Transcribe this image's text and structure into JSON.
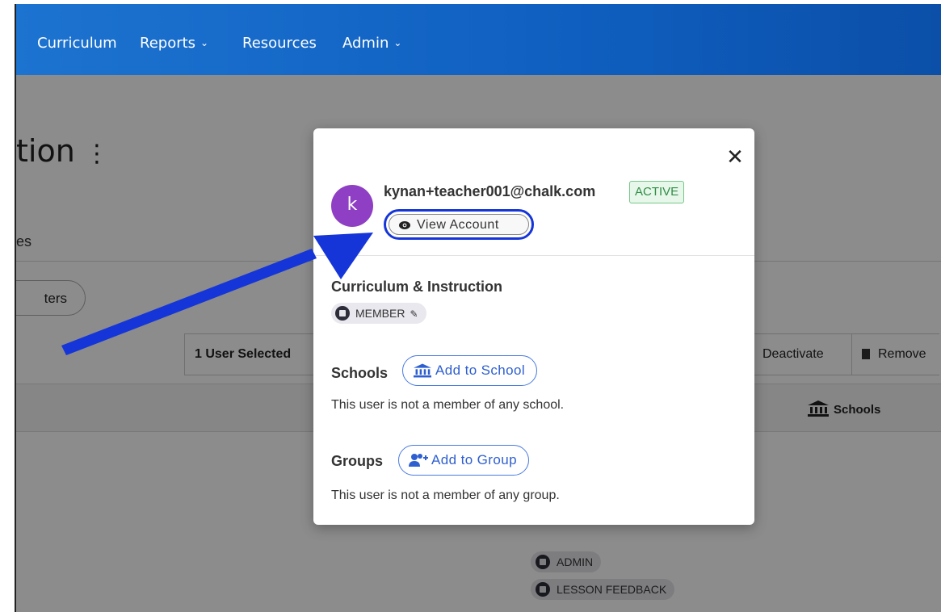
{
  "nav": {
    "items": [
      {
        "label": "Curriculum",
        "dropdown": false
      },
      {
        "label": "Reports",
        "dropdown": true
      },
      {
        "label": "Resources",
        "dropdown": false
      },
      {
        "label": "Admin",
        "dropdown": true
      }
    ],
    "chevron": "⌄"
  },
  "page": {
    "title_fragment": "tion",
    "title_menu_glyph": "⋮",
    "tab_fragment": "es",
    "filter_fragment": "ters",
    "bulk": {
      "selected": "1 User Selected",
      "deactivate": "Deactivate",
      "remove": "Remove"
    },
    "table": {
      "schools_header": "Schools"
    },
    "chips": [
      "ADMIN",
      "LESSON FEEDBACK"
    ]
  },
  "modal": {
    "avatar_initial": "k",
    "email": "kynan+teacher001@chalk.com",
    "status": "ACTIVE",
    "view_account": "View Account",
    "close_glyph": "✕",
    "org": {
      "name": "Curriculum & Instruction",
      "role": "MEMBER"
    },
    "schools": {
      "title": "Schools",
      "add_label": "Add to School",
      "empty": "This user is not a member of any school."
    },
    "groups": {
      "title": "Groups",
      "add_label": "Add to Group",
      "empty": "This user is not a member of any group."
    }
  },
  "colors": {
    "nav": "#1d73d0",
    "annotation_arrow": "#1535d9",
    "avatar": "#8e3fc4",
    "active_badge": "#2f8d45",
    "link": "#2e5fd0"
  }
}
